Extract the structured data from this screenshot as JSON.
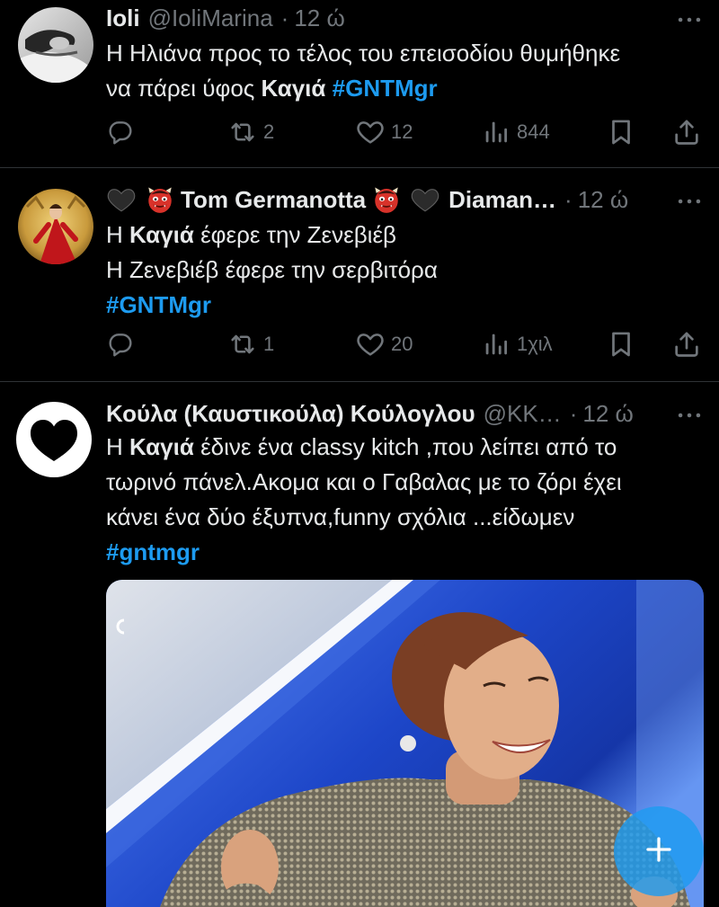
{
  "theme": {
    "background": "#000000",
    "text": "#e7e9ea",
    "muted": "#71767b",
    "accent": "#1d9bf0",
    "divider": "#2f3336"
  },
  "separator": "·",
  "tweets": [
    {
      "avatar_icon": "profile-photo-avatar",
      "display_name": "Ioli",
      "handle": "@IoliMarina",
      "time": "12 ώ",
      "text_lines": [
        [
          "Η Ηλιάνα προς το τέλος του επεισοδίου θυμήθηκε"
        ],
        [
          "να πάρει ύφος ",
          "Καγιά",
          "#GNTMgr"
        ]
      ],
      "actions": {
        "retweets": "2",
        "likes": "12",
        "views": "844"
      }
    },
    {
      "avatar_icon": "profile-photo-avatar",
      "name_emojis": [
        "black-heart",
        "ogre",
        "ogre",
        "black-heart"
      ],
      "display_name": "Tom Germanotta",
      "display_name_cont": "Diaman…",
      "time": "12 ώ",
      "text_lines": [
        [
          "Η ",
          "Καγιά",
          " έφερε την Ζενεβιέβ"
        ],
        [
          "Η Ζενεβιέβ έφερε την σερβιτόρα"
        ],
        [
          "#GNTMgr"
        ]
      ],
      "actions": {
        "retweets": "1",
        "likes": "20",
        "views": "1χιλ"
      }
    },
    {
      "avatar_icon": "black-heart-avatar",
      "display_name": "Κούλα (Καυστικούλα) Κούλογλου",
      "handle": "@KK…",
      "time": "12 ώ",
      "text_lines": [
        [
          "Η ",
          "Καγιά",
          " έδινε ένα classy kitch ,που λείπει από το"
        ],
        [
          "τωρινό πάνελ.Ακομα και ο Γαβαλας με το ζόρι έχει"
        ],
        [
          "κάνει ένα δύο έξυπνα,funny σχόλια ...είδωμεν"
        ],
        [
          "#gntmgr"
        ]
      ],
      "media": {
        "type": "image",
        "icon": "photo-media"
      }
    }
  ],
  "action_icons": [
    "reply-icon",
    "retweet-icon",
    "like-icon",
    "views-icon",
    "bookmark-icon",
    "share-icon"
  ],
  "compose": {
    "icon": "plus-icon",
    "color": "#1d9bf0"
  }
}
